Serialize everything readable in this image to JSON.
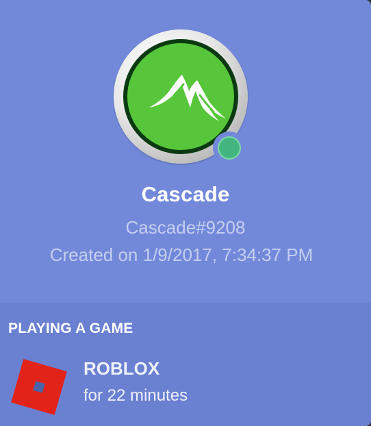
{
  "profile": {
    "display_name": "Cascade",
    "tag": "Cascade#9208",
    "created": "Created on 1/9/2017, 7:34:37 PM",
    "status": "online",
    "avatar_icon": "mountain-icon",
    "status_color": "#43b581"
  },
  "activity": {
    "header": "PLAYING A GAME",
    "game": {
      "name": "ROBLOX",
      "elapsed": "for 22 minutes",
      "icon": "roblox-logo-icon",
      "icon_color": "#e2231a"
    }
  },
  "colors": {
    "card_background": "#7289da",
    "activity_background": "#6a80d0",
    "avatar_green": "#57c63a"
  }
}
